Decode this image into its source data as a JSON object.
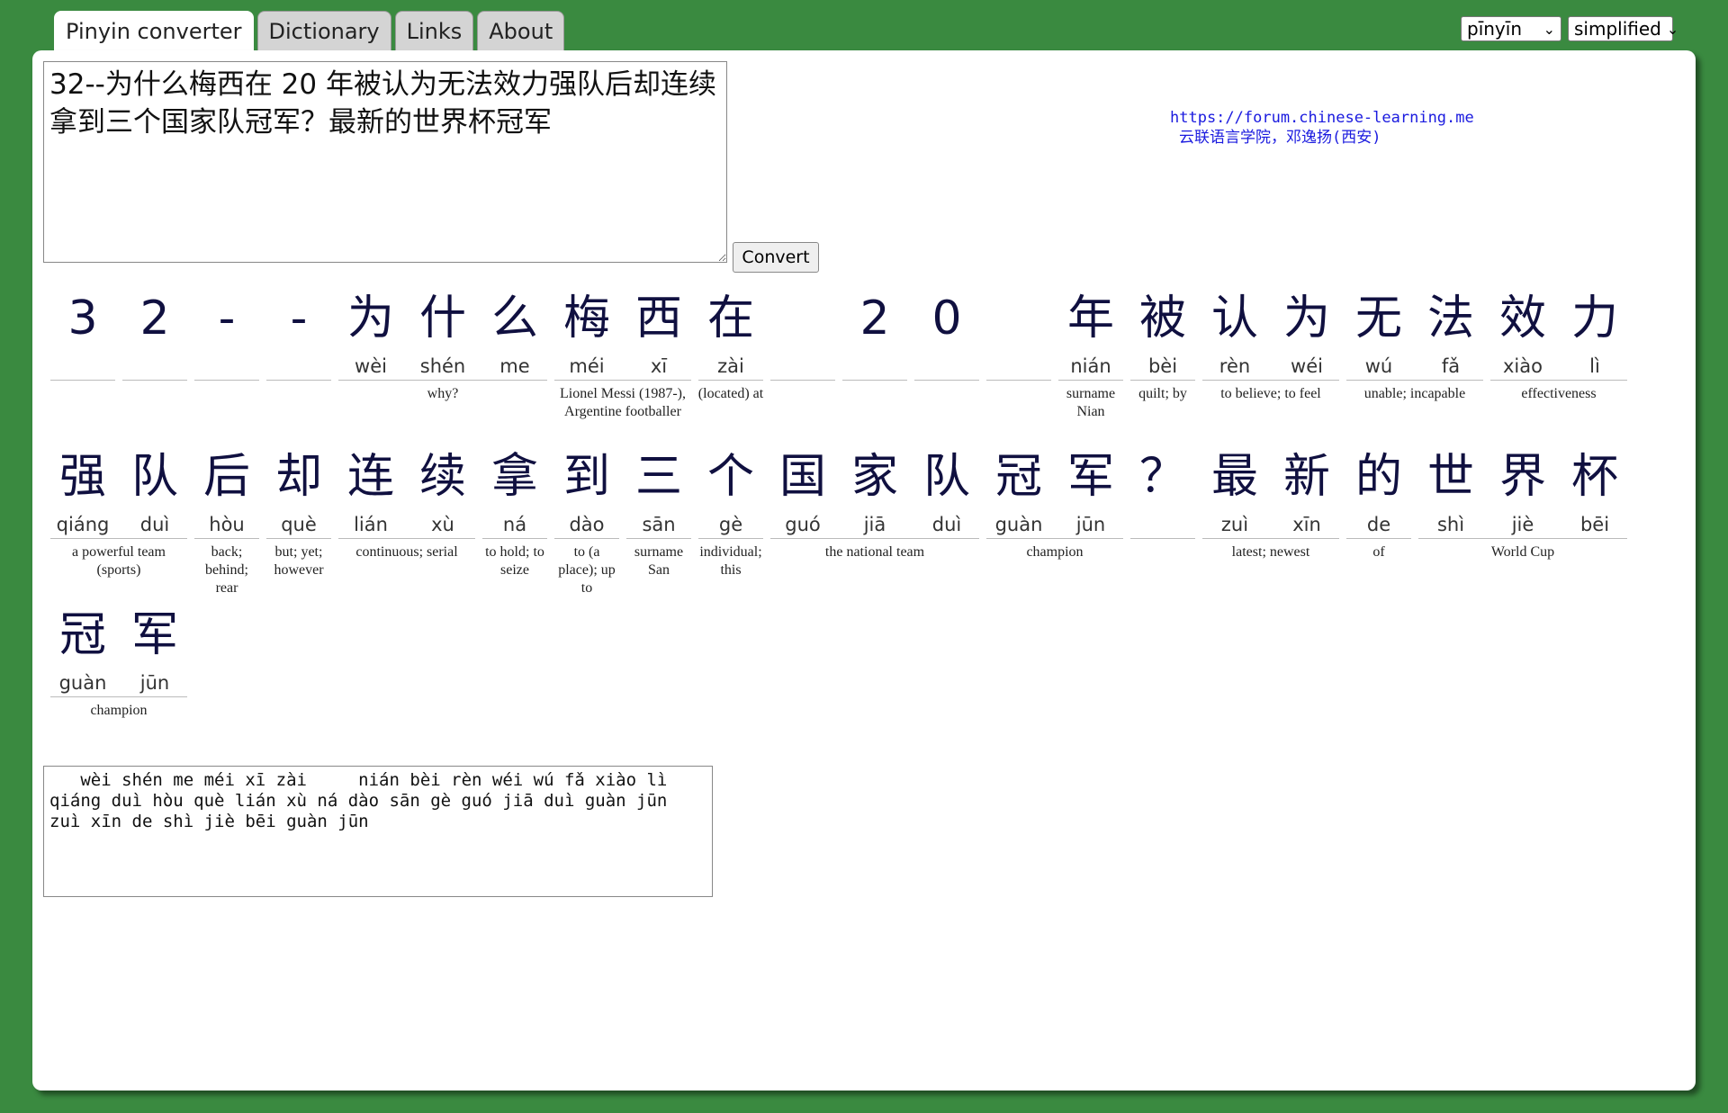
{
  "tabs": [
    "Pinyin converter",
    "Dictionary",
    "Links",
    "About"
  ],
  "selectors": {
    "romanization": "pīnyīn",
    "script": "simplified"
  },
  "input_text": "32--为什么梅西在 20 年被认为无法效力强队后却连续拿到三个国家队冠军？最新的世界杯冠军",
  "convert_label": "Convert",
  "credit": {
    "line1": "https://forum.chinese-learning.me",
    "line2": "云联语言学院，邓逸扬(西安)"
  },
  "rows": [
    [
      {
        "hz": "3",
        "py": ""
      },
      {
        "hz": "2",
        "py": ""
      },
      {
        "hz": "-",
        "py": ""
      },
      {
        "hz": "-",
        "py": ""
      },
      {
        "hz": "为",
        "py": "wèi"
      },
      {
        "hz": "什",
        "py": "shén"
      },
      {
        "hz": "么",
        "py": "me"
      },
      {
        "hz": "梅",
        "py": "méi"
      },
      {
        "hz": "西",
        "py": "xī"
      },
      {
        "hz": "在",
        "py": "zài"
      },
      {
        "hz": "",
        "py": ""
      },
      {
        "hz": "2",
        "py": ""
      },
      {
        "hz": "0",
        "py": ""
      },
      {
        "hz": "",
        "py": ""
      },
      {
        "hz": "年",
        "py": "nián"
      },
      {
        "hz": "被",
        "py": "bèi"
      },
      {
        "hz": "认",
        "py": "rèn"
      },
      {
        "hz": "为",
        "py": "wéi"
      },
      {
        "hz": "无",
        "py": "wú"
      },
      {
        "hz": "法",
        "py": "fǎ"
      },
      {
        "hz": "效",
        "py": "xiào"
      },
      {
        "hz": "力",
        "py": "lì"
      }
    ],
    [
      {
        "hz": "强",
        "py": "qiáng"
      },
      {
        "hz": "队",
        "py": "duì"
      },
      {
        "hz": "后",
        "py": "hòu"
      },
      {
        "hz": "却",
        "py": "què"
      },
      {
        "hz": "连",
        "py": "lián"
      },
      {
        "hz": "续",
        "py": "xù"
      },
      {
        "hz": "拿",
        "py": "ná"
      },
      {
        "hz": "到",
        "py": "dào"
      },
      {
        "hz": "三",
        "py": "sān"
      },
      {
        "hz": "个",
        "py": "gè"
      },
      {
        "hz": "国",
        "py": "guó"
      },
      {
        "hz": "家",
        "py": "jiā"
      },
      {
        "hz": "队",
        "py": "duì"
      },
      {
        "hz": "冠",
        "py": "guàn"
      },
      {
        "hz": "军",
        "py": "jūn"
      },
      {
        "hz": "？",
        "py": ""
      },
      {
        "hz": "最",
        "py": "zuì"
      },
      {
        "hz": "新",
        "py": "xīn"
      },
      {
        "hz": "的",
        "py": "de"
      },
      {
        "hz": "世",
        "py": "shì"
      },
      {
        "hz": "界",
        "py": "jiè"
      },
      {
        "hz": "杯",
        "py": "bēi"
      }
    ],
    [
      {
        "hz": "冠",
        "py": "guàn"
      },
      {
        "hz": "军",
        "py": "jūn"
      }
    ]
  ],
  "glosses": [
    [
      {
        "start": 4,
        "span": 3,
        "text": "why?"
      },
      {
        "start": 7,
        "span": 2,
        "text": "Lionel Messi (1987-), Argentine footballer"
      },
      {
        "start": 9,
        "span": 1,
        "text": "(located) at"
      },
      {
        "start": 14,
        "span": 1,
        "text": "surname Nian"
      },
      {
        "start": 15,
        "span": 1,
        "text": "quilt; by"
      },
      {
        "start": 16,
        "span": 2,
        "text": "to believe; to feel"
      },
      {
        "start": 18,
        "span": 2,
        "text": "unable; incapable"
      },
      {
        "start": 20,
        "span": 2,
        "text": "effectiveness"
      }
    ],
    [
      {
        "start": 0,
        "span": 2,
        "text": "a powerful team (sports)"
      },
      {
        "start": 2,
        "span": 1,
        "text": "back; behind; rear"
      },
      {
        "start": 3,
        "span": 1,
        "text": "but; yet; however"
      },
      {
        "start": 4,
        "span": 2,
        "text": "continuous; serial"
      },
      {
        "start": 6,
        "span": 1,
        "text": "to hold; to seize"
      },
      {
        "start": 7,
        "span": 1,
        "text": "to (a place); up to"
      },
      {
        "start": 8,
        "span": 1,
        "text": "surname San"
      },
      {
        "start": 9,
        "span": 1,
        "text": "individual; this"
      },
      {
        "start": 10,
        "span": 3,
        "text": "the national team"
      },
      {
        "start": 13,
        "span": 2,
        "text": "champion"
      },
      {
        "start": 15,
        "span": 1,
        "text": ""
      },
      {
        "start": 16,
        "span": 2,
        "text": "latest; newest"
      },
      {
        "start": 18,
        "span": 1,
        "text": "of"
      },
      {
        "start": 19,
        "span": 3,
        "text": "World Cup"
      }
    ],
    [
      {
        "start": 0,
        "span": 2,
        "text": "champion"
      }
    ]
  ],
  "output_text": "   wèi shén me méi xī zài     nián bèi rèn wéi wú fǎ xiào lì\nqiáng duì hòu què lián xù ná dào sān gè guó jiā duì guàn jūn\nzuì xīn de shì jiè bēi guàn jūn"
}
